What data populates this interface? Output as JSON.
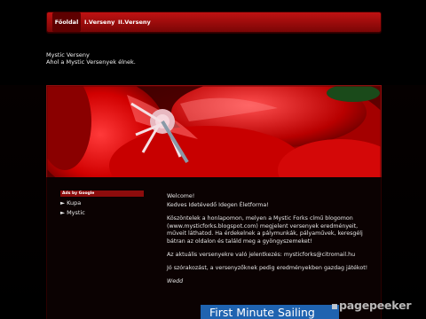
{
  "nav": {
    "items": [
      {
        "label": "Főoldal",
        "active": true
      },
      {
        "label": "I.Verseny",
        "active": false
      },
      {
        "label": "II.Verseny",
        "active": false
      }
    ]
  },
  "site": {
    "title": "Mystic Verseny",
    "subtitle": "Ahol a Mystic Versenyek élnek."
  },
  "sidebar": {
    "ads_label": "Ads by Google",
    "links": [
      "► Kupa",
      "► Mystic"
    ]
  },
  "main": {
    "paragraphs": [
      "Welcome!",
      "Kedves Idetévedő Idegen Életforma!",
      "Köszöntelek a honlapomon, melyen a Mystic Forks című blogomon (www.mysticforks.blogspot.com) megjelent versenyek eredményeit, műveit láthatod. Ha érdekelnek a pálymunkák, pályaművek, keresgélj bátran az oldalon és találd meg a gyöngyszemeket!",
      "Az aktuális versenyekre való jelentkezés: mysticforks@citromail.hu",
      "Jó szórakozást, a versenyzőknek pedig eredményekben gazdag játékot!",
      "Wedd"
    ]
  },
  "ad": {
    "text": "First Minute Sailing"
  },
  "watermark": {
    "text": "pagepeeker"
  },
  "colors": {
    "nav_red": "#c01212",
    "accent_red": "#8c0c0c",
    "ad_blue": "#1f63b0",
    "background": "#000000"
  }
}
